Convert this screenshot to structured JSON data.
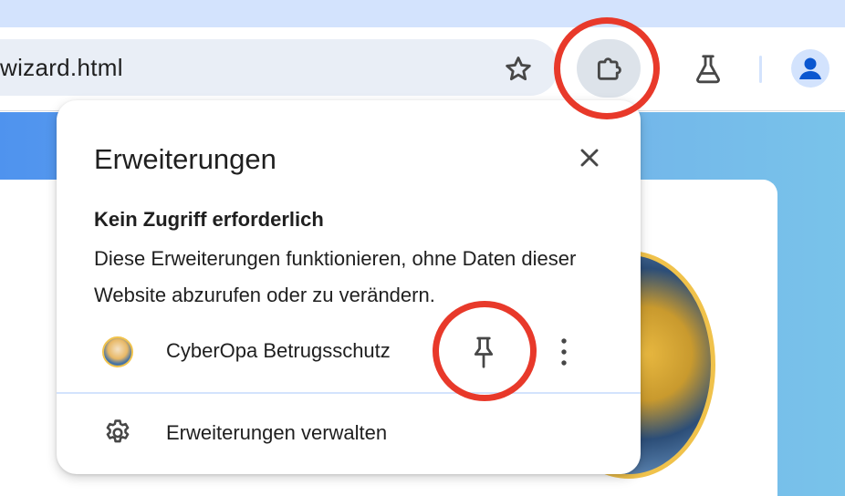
{
  "browser": {
    "url_text": "wizard.html",
    "icons": {
      "bookmark": "star-icon",
      "extensions": "puzzle-icon",
      "labs": "flask-icon",
      "profile": "person-icon"
    }
  },
  "extensions_popup": {
    "title": "Erweiterungen",
    "section_heading": "Kein Zugriff erforderlich",
    "section_description": "Diese Erweiterungen funktionieren, ohne Daten dieser Website abzurufen oder zu verändern.",
    "extensions": [
      {
        "name": "CyberOpa Betrugsschutz"
      }
    ],
    "manage_label": "Erweiterungen verwalten"
  },
  "colors": {
    "highlight": "#e8392a",
    "accent": "#0b57d0",
    "tabstrip": "#d3e3fd"
  }
}
